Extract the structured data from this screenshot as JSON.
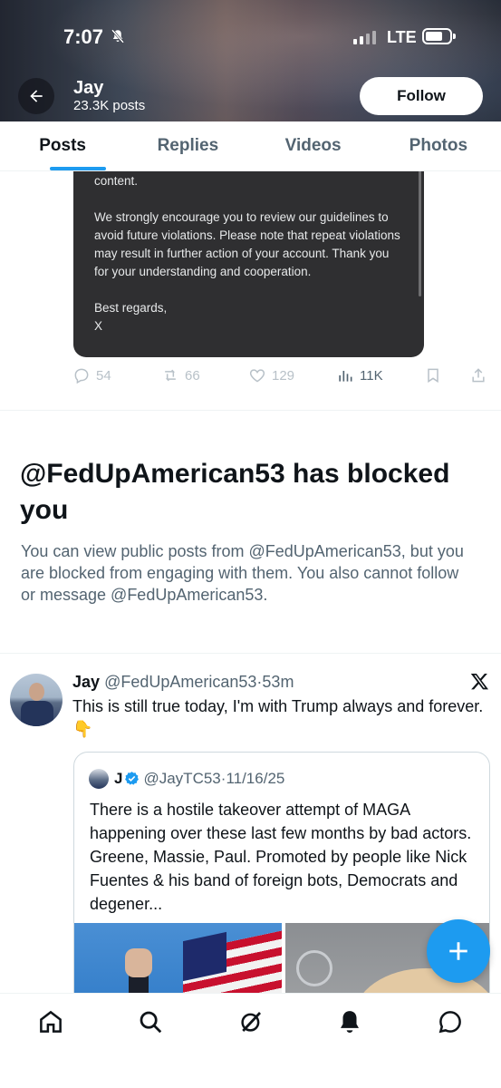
{
  "status_bar": {
    "time": "7:07",
    "network": "LTE"
  },
  "profile": {
    "name": "Jay",
    "posts": "23.3K posts",
    "follow_label": "Follow"
  },
  "tabs": [
    {
      "label": "Posts",
      "active": true
    },
    {
      "label": "Replies",
      "active": false
    },
    {
      "label": "Videos",
      "active": false
    },
    {
      "label": "Photos",
      "active": false
    }
  ],
  "notice_card": {
    "line1": "content.",
    "paragraph2": "We strongly encourage you to review our guidelines to avoid future violations. Please note that repeat violations may result in further action of your account. Thank you for your understanding and cooperation.",
    "closing": "Best regards,",
    "signature": "X"
  },
  "post_actions": {
    "replies": "54",
    "reposts": "66",
    "likes": "129",
    "views": "11K"
  },
  "blocked": {
    "title": "@FedUpAmerican53 has blocked you",
    "description": "You can view public posts from @FedUpAmerican53, but you are blocked from engaging with them. You also cannot follow or message @FedUpAmerican53."
  },
  "tweet": {
    "name": "Jay",
    "handle": "@FedUpAmerican53",
    "separator": "·",
    "time": "53m",
    "text": "This is still true today, I'm with Trump always and forever. 👇"
  },
  "quoted_tweet": {
    "name": "J",
    "handle": "@JayTC53",
    "separator": "·",
    "date": "11/16/25",
    "text": "There is a hostile takeover attempt of MAGA happening over these last few months by bad actors. Greene, Massie, Paul. Promoted by people like Nick Fuentes & his band of foreign bots, Democrats and degener..."
  },
  "colors": {
    "accent": "#1d9bf0",
    "card_dark": "#2f2f31",
    "text_secondary": "#536471"
  }
}
